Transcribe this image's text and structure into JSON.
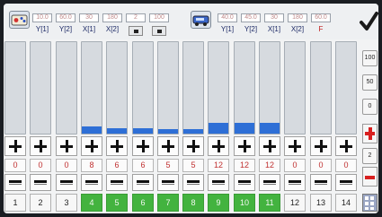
{
  "colors": {
    "bar_fill": "#2e6fd6",
    "active_channel": "#43b33f",
    "value_text": "#c03030",
    "label_text": "#1d2a66",
    "accent_red": "#c01818"
  },
  "icons": {
    "left_group": "controller-icon",
    "right_group": "vehicle-icon",
    "confirm": "checkmark-icon",
    "side_plus": "plus-icon",
    "side_minus": "minus-icon",
    "corner": "grid-icon"
  },
  "params_left": [
    {
      "value": "10.0",
      "label": "Y[1]"
    },
    {
      "value": "60.0",
      "label": "Y[2]"
    },
    {
      "value": "30",
      "label": "X[1]"
    },
    {
      "value": "180",
      "label": "X[2]"
    },
    {
      "value": "2",
      "label": ""
    },
    {
      "value": "100",
      "label": ""
    }
  ],
  "params_right": [
    {
      "value": "40.0",
      "label": "Y[1]"
    },
    {
      "value": "45.0",
      "label": "Y[2]"
    },
    {
      "value": "30",
      "label": "X[1]"
    },
    {
      "value": "180",
      "label": "X[2]"
    },
    {
      "value": "60.0",
      "label": "F"
    }
  ],
  "channels": [
    {
      "number": "1",
      "value": "0",
      "level": 0,
      "active": false
    },
    {
      "number": "2",
      "value": "0",
      "level": 0,
      "active": false
    },
    {
      "number": "3",
      "value": "0",
      "level": 0,
      "active": false
    },
    {
      "number": "4",
      "value": "8",
      "level": 0.08,
      "active": true
    },
    {
      "number": "5",
      "value": "6",
      "level": 0.06,
      "active": true
    },
    {
      "number": "6",
      "value": "6",
      "level": 0.06,
      "active": true
    },
    {
      "number": "7",
      "value": "5",
      "level": 0.05,
      "active": true
    },
    {
      "number": "8",
      "value": "5",
      "level": 0.05,
      "active": true
    },
    {
      "number": "9",
      "value": "12",
      "level": 0.12,
      "active": true
    },
    {
      "number": "10",
      "value": "12",
      "level": 0.12,
      "active": true
    },
    {
      "number": "11",
      "value": "12",
      "level": 0.12,
      "active": true
    },
    {
      "number": "12",
      "value": "0",
      "level": 0,
      "active": false
    },
    {
      "number": "13",
      "value": "0",
      "level": 0,
      "active": false
    },
    {
      "number": "14",
      "value": "0",
      "level": 0,
      "active": false
    }
  ],
  "side_buttons": [
    "100",
    "50",
    "0",
    "2"
  ]
}
